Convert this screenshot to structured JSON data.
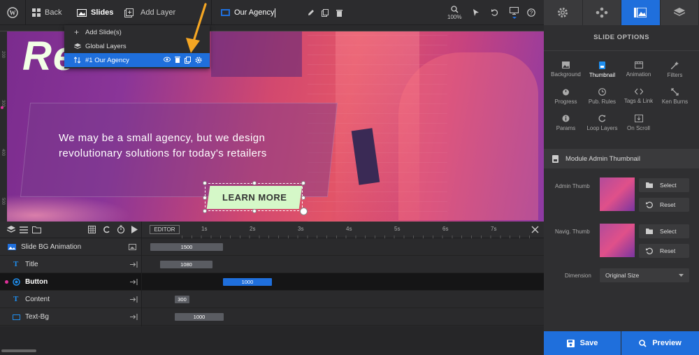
{
  "topbar": {
    "back_label": "Back",
    "slides_label": "Slides",
    "add_layer_label": "Add Layer",
    "slide_name": "Our Agency",
    "zoom": "100%"
  },
  "slides_menu": {
    "items": [
      "Add Slide(s)",
      "Global Layers",
      "#1 Our Agency"
    ]
  },
  "stage": {
    "content_line1": "We may be a small agency, but we design",
    "content_line2": "revolutionary solutions for today's retailers",
    "button_label": "LEARN MORE",
    "title_fragment": "Re"
  },
  "ruler": {
    "marks": [
      "200",
      "300",
      "400",
      "500"
    ]
  },
  "timeline": {
    "editor_label": "EDITOR",
    "ticks": [
      "1s",
      "2s",
      "3s",
      "4s",
      "5s",
      "6s",
      "7s"
    ],
    "layers": [
      {
        "name": "Slide BG Animation",
        "duration": "1500"
      },
      {
        "name": "Title",
        "duration": "1080"
      },
      {
        "name": "Button",
        "duration": "1000"
      },
      {
        "name": "Content",
        "duration": "300"
      },
      {
        "name": "Text-Bg",
        "duration": "1000"
      }
    ]
  },
  "panel": {
    "title": "SLIDE OPTIONS",
    "options": [
      "Background",
      "Thumbnail",
      "Animation",
      "Filters",
      "Progress",
      "Pub. Rules",
      "Tags & Link",
      "Ken Burns",
      "Params",
      "Loop Layers",
      "On Scroll"
    ],
    "module_header": "Module Admin Thumbnail",
    "admin_thumb_label": "Admin Thumb",
    "navig_thumb_label": "Navig. Thumb",
    "select_label": "Select",
    "reset_label": "Reset",
    "dimension_label": "Dimension",
    "dimension_value": "Original Size",
    "save_label": "Save",
    "preview_label": "Preview"
  },
  "colors": {
    "accent": "#1f6fdc",
    "button_bg": "#d5f8c8",
    "annotation_arrow": "#f5a623"
  }
}
